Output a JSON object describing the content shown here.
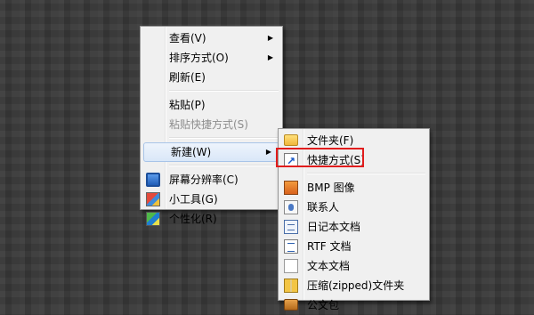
{
  "context_menu": {
    "items": [
      {
        "label": "查看(V)",
        "has_submenu": true
      },
      {
        "label": "排序方式(O)",
        "has_submenu": true
      },
      {
        "label": "刷新(E)"
      },
      {
        "label": "粘贴(P)"
      },
      {
        "label": "粘贴快捷方式(S)",
        "disabled": true
      },
      {
        "label": "新建(W)",
        "has_submenu": true,
        "highlighted": true
      },
      {
        "label": "屏幕分辨率(C)",
        "icon": "monitor-icon"
      },
      {
        "label": "小工具(G)",
        "icon": "gadgets-icon"
      },
      {
        "label": "个性化(R)",
        "icon": "personalize-icon"
      }
    ]
  },
  "new_submenu": {
    "items": [
      {
        "label": "文件夹(F)",
        "icon": "folder-icon"
      },
      {
        "label": "快捷方式(S)",
        "icon": "shortcut-icon"
      },
      {
        "label": "BMP 图像",
        "icon": "bitmap-image-icon"
      },
      {
        "label": "联系人",
        "icon": "contact-icon"
      },
      {
        "label": "日记本文档",
        "icon": "journal-document-icon"
      },
      {
        "label": "RTF 文档",
        "icon": "rtf-document-icon"
      },
      {
        "label": "文本文档",
        "icon": "text-document-icon"
      },
      {
        "label": "压缩(zipped)文件夹",
        "icon": "zip-folder-icon"
      },
      {
        "label": "公文包",
        "icon": "briefcase-icon"
      }
    ]
  },
  "colors": {
    "highlight_box": "#e11d1d",
    "menu_bg": "#f0f0f0"
  }
}
